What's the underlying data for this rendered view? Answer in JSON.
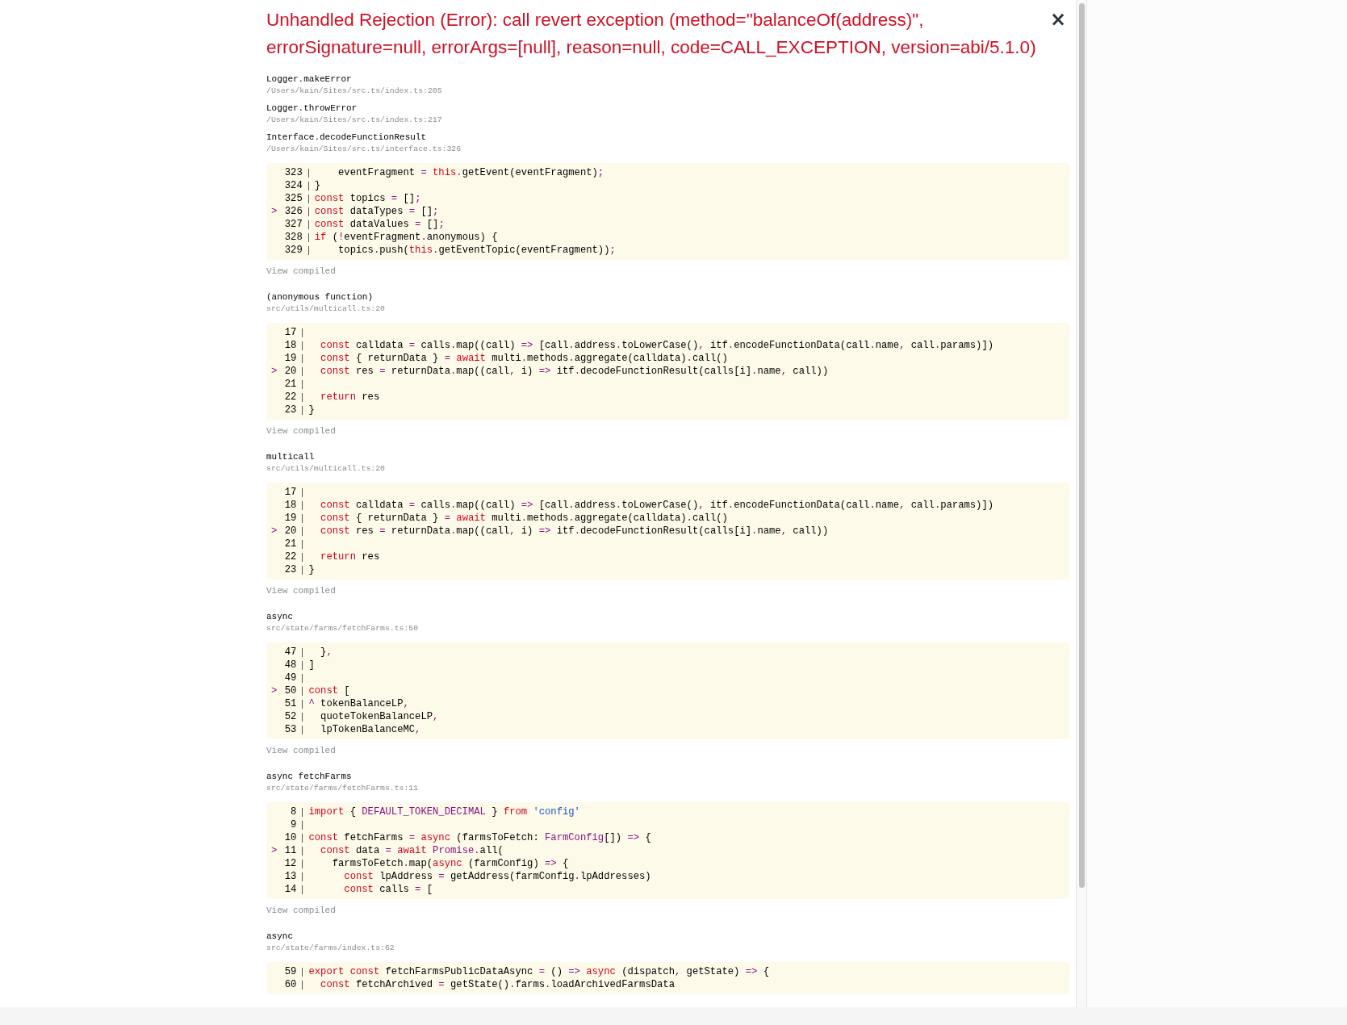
{
  "error": {
    "title": "Unhandled Rejection (Error): call revert exception (method=\"balanceOf(address)\", errorSignature=null, errorArgs=[null], reason=null, code=CALL_EXCEPTION, version=abi/5.1.0)",
    "close": "×"
  },
  "frames": [
    {
      "name": "Logger.makeError",
      "file": "/Users/kain/Sites/src.ts/index.ts:205"
    },
    {
      "name": "Logger.throwError",
      "file": "/Users/kain/Sites/src.ts/index.ts:217"
    },
    {
      "name": "Interface.decodeFunctionResult",
      "file": "/Users/kain/Sites/src.ts/interface.ts:326",
      "link": "View compiled",
      "code": [
        {
          "number": "323",
          "highlighted": false,
          "tokens": [
            {
              "kind": "text",
              "text": "    eventFragment "
            },
            {
              "kind": "accent",
              "text": "= "
            },
            {
              "kind": "keyword",
              "text": "this"
            },
            {
              "kind": "accent",
              "text": "."
            },
            {
              "kind": "text",
              "text": "getEvent(eventFragment)"
            },
            {
              "kind": "accent",
              "text": ";"
            }
          ]
        },
        {
          "number": "324",
          "highlighted": false,
          "tokens": [
            {
              "kind": "text",
              "text": "}"
            }
          ]
        },
        {
          "number": "325",
          "highlighted": false,
          "tokens": [
            {
              "kind": "keyword",
              "text": "const"
            },
            {
              "kind": "text",
              "text": " topics "
            },
            {
              "kind": "accent",
              "text": "="
            },
            {
              "kind": "text",
              "text": " []"
            },
            {
              "kind": "accent",
              "text": ";"
            }
          ]
        },
        {
          "number": "326",
          "highlighted": true,
          "pointer": ">",
          "tokens": [
            {
              "kind": "keyword",
              "text": "const"
            },
            {
              "kind": "text",
              "text": " dataTypes "
            },
            {
              "kind": "accent",
              "text": "="
            },
            {
              "kind": "text",
              "text": " []"
            },
            {
              "kind": "accent",
              "text": ";"
            }
          ]
        },
        {
          "number": "327",
          "highlighted": false,
          "tokens": [
            {
              "kind": "keyword",
              "text": "const"
            },
            {
              "kind": "text",
              "text": " dataValues "
            },
            {
              "kind": "accent",
              "text": "="
            },
            {
              "kind": "text",
              "text": " []"
            },
            {
              "kind": "accent",
              "text": ";"
            }
          ]
        },
        {
          "number": "328",
          "highlighted": false,
          "tokens": [
            {
              "kind": "keyword",
              "text": "if"
            },
            {
              "kind": "text",
              "text": " ("
            },
            {
              "kind": "accent",
              "text": "!"
            },
            {
              "kind": "text",
              "text": "eventFragment"
            },
            {
              "kind": "accent",
              "text": "."
            },
            {
              "kind": "text",
              "text": "anonymous) {"
            }
          ]
        },
        {
          "number": "329",
          "highlighted": false,
          "tokens": [
            {
              "kind": "text",
              "text": "    topics"
            },
            {
              "kind": "accent",
              "text": "."
            },
            {
              "kind": "text",
              "text": "push("
            },
            {
              "kind": "keyword",
              "text": "this"
            },
            {
              "kind": "accent",
              "text": "."
            },
            {
              "kind": "text",
              "text": "getEventTopic(eventFragment))"
            },
            {
              "kind": "accent",
              "text": ";"
            }
          ]
        }
      ]
    },
    {
      "name": "(anonymous function)",
      "file": "src/utils/multicall.ts:20",
      "link": "View compiled",
      "code": [
        {
          "number": "17",
          "highlighted": false
        },
        {
          "number": "18",
          "highlighted": false,
          "tokens": [
            {
              "kind": "keyword",
              "text": "  const"
            },
            {
              "kind": "text",
              "text": " calldata "
            },
            {
              "kind": "accent",
              "text": "="
            },
            {
              "kind": "text",
              "text": " calls"
            },
            {
              "kind": "accent",
              "text": "."
            },
            {
              "kind": "text",
              "text": "map((call) "
            },
            {
              "kind": "accent",
              "text": "=>"
            },
            {
              "kind": "text",
              "text": " [call"
            },
            {
              "kind": "accent",
              "text": "."
            },
            {
              "kind": "text",
              "text": "address"
            },
            {
              "kind": "accent",
              "text": "."
            },
            {
              "kind": "text",
              "text": "toLowerCase()"
            },
            {
              "kind": "accent",
              "text": ","
            },
            {
              "kind": "text",
              "text": " itf"
            },
            {
              "kind": "accent",
              "text": "."
            },
            {
              "kind": "text",
              "text": "encodeFunctionData(call"
            },
            {
              "kind": "accent",
              "text": "."
            },
            {
              "kind": "text",
              "text": "name"
            },
            {
              "kind": "accent",
              "text": ","
            },
            {
              "kind": "text",
              "text": " call"
            },
            {
              "kind": "accent",
              "text": "."
            },
            {
              "kind": "text",
              "text": "params)])"
            }
          ]
        },
        {
          "number": "19",
          "highlighted": false,
          "tokens": [
            {
              "kind": "keyword",
              "text": "  const"
            },
            {
              "kind": "text",
              "text": " { returnData } "
            },
            {
              "kind": "accent",
              "text": "= "
            },
            {
              "kind": "keyword",
              "text": "await"
            },
            {
              "kind": "text",
              "text": " multi"
            },
            {
              "kind": "accent",
              "text": "."
            },
            {
              "kind": "text",
              "text": "methods"
            },
            {
              "kind": "accent",
              "text": "."
            },
            {
              "kind": "text",
              "text": "aggregate(calldata)"
            },
            {
              "kind": "accent",
              "text": "."
            },
            {
              "kind": "text",
              "text": "call()"
            }
          ]
        },
        {
          "number": "20",
          "highlighted": true,
          "pointer": ">",
          "tokens": [
            {
              "kind": "keyword",
              "text": "  const"
            },
            {
              "kind": "text",
              "text": " res "
            },
            {
              "kind": "accent",
              "text": "="
            },
            {
              "kind": "text",
              "text": " returnData"
            },
            {
              "kind": "accent",
              "text": "."
            },
            {
              "kind": "text",
              "text": "map((call"
            },
            {
              "kind": "accent",
              "text": ","
            },
            {
              "kind": "text",
              "text": " i) "
            },
            {
              "kind": "accent",
              "text": "=>"
            },
            {
              "kind": "text",
              "text": " itf"
            },
            {
              "kind": "accent",
              "text": "."
            },
            {
              "kind": "text",
              "text": "decodeFunctionResult(calls[i]"
            },
            {
              "kind": "accent",
              "text": "."
            },
            {
              "kind": "text",
              "text": "name"
            },
            {
              "kind": "accent",
              "text": ","
            },
            {
              "kind": "text",
              "text": " call))"
            }
          ]
        },
        {
          "number": "21",
          "highlighted": false
        },
        {
          "number": "22",
          "highlighted": false,
          "tokens": [
            {
              "kind": "keyword",
              "text": "  return"
            },
            {
              "kind": "text",
              "text": " res"
            }
          ]
        },
        {
          "number": "23",
          "highlighted": false,
          "tokens": [
            {
              "kind": "text",
              "text": "}"
            }
          ]
        }
      ]
    },
    {
      "name": "multicall",
      "file": "src/utils/multicall.ts:20",
      "link": "View compiled",
      "code": [
        {
          "number": "17",
          "highlighted": false
        },
        {
          "number": "18",
          "highlighted": false,
          "tokens": [
            {
              "kind": "keyword",
              "text": "  const"
            },
            {
              "kind": "text",
              "text": " calldata "
            },
            {
              "kind": "accent",
              "text": "="
            },
            {
              "kind": "text",
              "text": " calls"
            },
            {
              "kind": "accent",
              "text": "."
            },
            {
              "kind": "text",
              "text": "map((call) "
            },
            {
              "kind": "accent",
              "text": "=>"
            },
            {
              "kind": "text",
              "text": " [call"
            },
            {
              "kind": "accent",
              "text": "."
            },
            {
              "kind": "text",
              "text": "address"
            },
            {
              "kind": "accent",
              "text": "."
            },
            {
              "kind": "text",
              "text": "toLowerCase()"
            },
            {
              "kind": "accent",
              "text": ","
            },
            {
              "kind": "text",
              "text": " itf"
            },
            {
              "kind": "accent",
              "text": "."
            },
            {
              "kind": "text",
              "text": "encodeFunctionData(call"
            },
            {
              "kind": "accent",
              "text": "."
            },
            {
              "kind": "text",
              "text": "name"
            },
            {
              "kind": "accent",
              "text": ","
            },
            {
              "kind": "text",
              "text": " call"
            },
            {
              "kind": "accent",
              "text": "."
            },
            {
              "kind": "text",
              "text": "params)])"
            }
          ]
        },
        {
          "number": "19",
          "highlighted": false,
          "tokens": [
            {
              "kind": "keyword",
              "text": "  const"
            },
            {
              "kind": "text",
              "text": " { returnData } "
            },
            {
              "kind": "accent",
              "text": "= "
            },
            {
              "kind": "keyword",
              "text": "await"
            },
            {
              "kind": "text",
              "text": " multi"
            },
            {
              "kind": "accent",
              "text": "."
            },
            {
              "kind": "text",
              "text": "methods"
            },
            {
              "kind": "accent",
              "text": "."
            },
            {
              "kind": "text",
              "text": "aggregate(calldata)"
            },
            {
              "kind": "accent",
              "text": "."
            },
            {
              "kind": "text",
              "text": "call()"
            }
          ]
        },
        {
          "number": "20",
          "highlighted": true,
          "pointer": ">",
          "tokens": [
            {
              "kind": "keyword",
              "text": "  const"
            },
            {
              "kind": "text",
              "text": " res "
            },
            {
              "kind": "accent",
              "text": "="
            },
            {
              "kind": "text",
              "text": " returnData"
            },
            {
              "kind": "accent",
              "text": "."
            },
            {
              "kind": "text",
              "text": "map((call"
            },
            {
              "kind": "accent",
              "text": ","
            },
            {
              "kind": "text",
              "text": " i) "
            },
            {
              "kind": "accent",
              "text": "=>"
            },
            {
              "kind": "text",
              "text": " itf"
            },
            {
              "kind": "accent",
              "text": "."
            },
            {
              "kind": "text",
              "text": "decodeFunctionResult(calls[i]"
            },
            {
              "kind": "accent",
              "text": "."
            },
            {
              "kind": "text",
              "text": "name"
            },
            {
              "kind": "accent",
              "text": ","
            },
            {
              "kind": "text",
              "text": " call))"
            }
          ]
        },
        {
          "number": "21",
          "highlighted": false
        },
        {
          "number": "22",
          "highlighted": false,
          "tokens": [
            {
              "kind": "keyword",
              "text": "  return"
            },
            {
              "kind": "text",
              "text": " res"
            }
          ]
        },
        {
          "number": "23",
          "highlighted": false,
          "tokens": [
            {
              "kind": "text",
              "text": "}"
            }
          ]
        }
      ]
    },
    {
      "name": "async",
      "file": "src/state/farms/fetchFarms.ts:50",
      "link": "View compiled",
      "code": [
        {
          "number": "47",
          "highlighted": false,
          "tokens": [
            {
              "kind": "text",
              "text": "  }"
            },
            {
              "kind": "accent",
              "text": ","
            }
          ]
        },
        {
          "number": "48",
          "highlighted": false,
          "tokens": [
            {
              "kind": "text",
              "text": "]"
            }
          ]
        },
        {
          "number": "49",
          "highlighted": false
        },
        {
          "number": "50",
          "highlighted": true,
          "pointer": ">",
          "tokens": [
            {
              "kind": "keyword",
              "text": "const"
            },
            {
              "kind": "text",
              "text": " ["
            }
          ]
        },
        {
          "number": "51",
          "highlighted": false,
          "tokens": [
            {
              "kind": "accent",
              "text": "^"
            },
            {
              "kind": "text",
              "text": " tokenBalanceLP"
            },
            {
              "kind": "accent",
              "text": ","
            }
          ]
        },
        {
          "number": "52",
          "highlighted": false,
          "tokens": [
            {
              "kind": "text",
              "text": "  quoteTokenBalanceLP"
            },
            {
              "kind": "accent",
              "text": ","
            }
          ]
        },
        {
          "number": "53",
          "highlighted": false,
          "tokens": [
            {
              "kind": "text",
              "text": "  lpTokenBalanceMC"
            },
            {
              "kind": "accent",
              "text": ","
            }
          ]
        }
      ]
    },
    {
      "name": "async fetchFarms",
      "file": "src/state/farms/fetchFarms.ts:11",
      "link": "View compiled",
      "code": [
        {
          "number": "8",
          "highlighted": false,
          "tokens": [
            {
              "kind": "keyword",
              "text": "import"
            },
            {
              "kind": "text",
              "text": " { "
            },
            {
              "kind": "accent",
              "text": "DEFAULT_TOKEN_DECIMAL"
            },
            {
              "kind": "text",
              "text": " } "
            },
            {
              "kind": "keyword",
              "text": "from"
            },
            {
              "kind": "string",
              "text": " 'config'"
            }
          ]
        },
        {
          "number": "9",
          "highlighted": false
        },
        {
          "number": "10",
          "highlighted": false,
          "tokens": [
            {
              "kind": "keyword",
              "text": "const"
            },
            {
              "kind": "text",
              "text": " fetchFarms "
            },
            {
              "kind": "accent",
              "text": "= "
            },
            {
              "kind": "keyword",
              "text": "async"
            },
            {
              "kind": "text",
              "text": " (farmsToFetch: "
            },
            {
              "kind": "accent",
              "text": "FarmConfig"
            },
            {
              "kind": "text",
              "text": "[]) "
            },
            {
              "kind": "accent",
              "text": "=>"
            },
            {
              "kind": "text",
              "text": " {"
            }
          ]
        },
        {
          "number": "11",
          "highlighted": true,
          "pointer": ">",
          "tokens": [
            {
              "kind": "keyword",
              "text": "  const"
            },
            {
              "kind": "text",
              "text": " data "
            },
            {
              "kind": "accent",
              "text": "= "
            },
            {
              "kind": "keyword",
              "text": "await"
            },
            {
              "kind": "accent",
              "text": " Promise."
            },
            {
              "kind": "text",
              "text": "all("
            }
          ]
        },
        {
          "number": "12",
          "highlighted": false,
          "tokens": [
            {
              "kind": "text",
              "text": "    farmsToFetch"
            },
            {
              "kind": "accent",
              "text": "."
            },
            {
              "kind": "text",
              "text": "map("
            },
            {
              "kind": "keyword",
              "text": "async"
            },
            {
              "kind": "text",
              "text": " (farmConfig) "
            },
            {
              "kind": "accent",
              "text": "=>"
            },
            {
              "kind": "text",
              "text": " {"
            }
          ]
        },
        {
          "number": "13",
          "highlighted": false,
          "tokens": [
            {
              "kind": "keyword",
              "text": "      const"
            },
            {
              "kind": "text",
              "text": " lpAddress "
            },
            {
              "kind": "accent",
              "text": "="
            },
            {
              "kind": "text",
              "text": " getAddress(farmConfig"
            },
            {
              "kind": "accent",
              "text": "."
            },
            {
              "kind": "text",
              "text": "lpAddresses)"
            }
          ]
        },
        {
          "number": "14",
          "highlighted": false,
          "tokens": [
            {
              "kind": "keyword",
              "text": "      const"
            },
            {
              "kind": "text",
              "text": " calls "
            },
            {
              "kind": "accent",
              "text": "="
            },
            {
              "kind": "text",
              "text": " ["
            }
          ]
        }
      ]
    },
    {
      "name": "async",
      "file": "src/state/farms/index.ts:62",
      "code": [
        {
          "number": "59",
          "highlighted": false,
          "tokens": [
            {
              "kind": "keyword",
              "text": "export const"
            },
            {
              "kind": "text",
              "text": " fetchFarmsPublicDataAsync "
            },
            {
              "kind": "accent",
              "text": "="
            },
            {
              "kind": "text",
              "text": " () "
            },
            {
              "kind": "accent",
              "text": "=> "
            },
            {
              "kind": "keyword",
              "text": "async"
            },
            {
              "kind": "text",
              "text": " (dispatch"
            },
            {
              "kind": "accent",
              "text": ","
            },
            {
              "kind": "text",
              "text": " getState) "
            },
            {
              "kind": "accent",
              "text": "=>"
            },
            {
              "kind": "text",
              "text": " {"
            }
          ]
        },
        {
          "number": "60",
          "highlighted": false,
          "tokens": [
            {
              "kind": "keyword",
              "text": "  const"
            },
            {
              "kind": "text",
              "text": " fetchArchived "
            },
            {
              "kind": "accent",
              "text": "="
            },
            {
              "kind": "text",
              "text": " getState()"
            },
            {
              "kind": "accent",
              "text": "."
            },
            {
              "kind": "text",
              "text": "farms"
            },
            {
              "kind": "accent",
              "text": "."
            },
            {
              "kind": "text",
              "text": "loadArchivedFarmsData"
            }
          ]
        }
      ]
    }
  ]
}
